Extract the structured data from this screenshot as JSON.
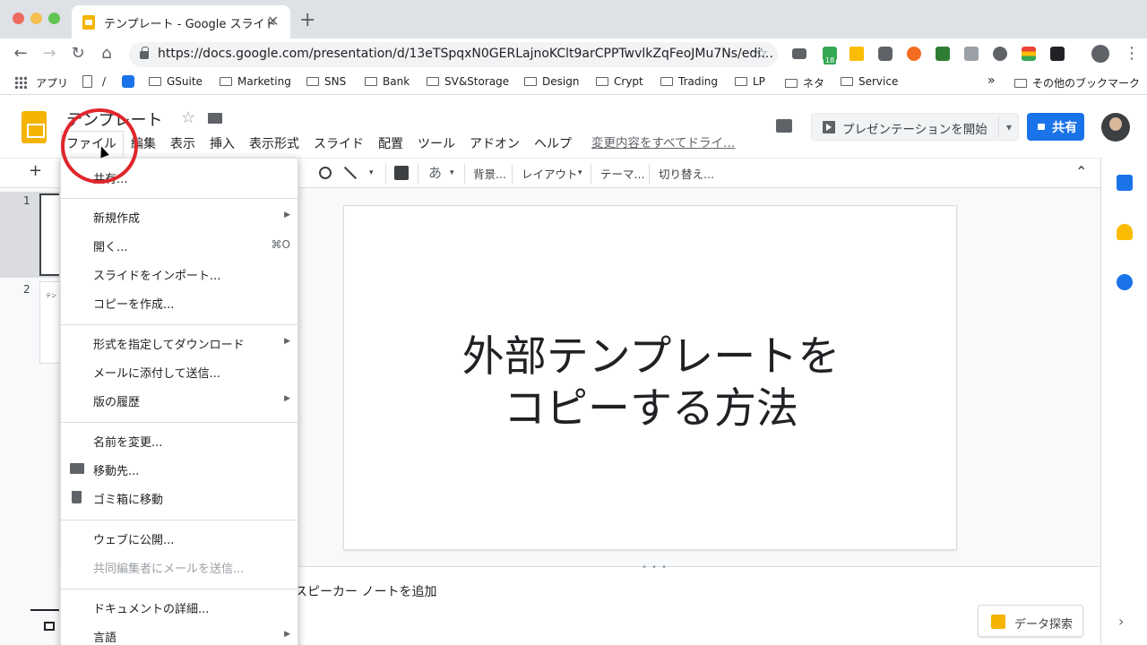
{
  "browser": {
    "tab_title": "テンプレート - Google スライド",
    "tab_close": "✕",
    "new_tab": "+",
    "url": "https://docs.google.com/presentation/d/13eTSpqxN0GERLajnoKClt9arCPPTwvlkZqFeoJMu7Ns/edi…",
    "ext_badge": "18"
  },
  "bookmarks": {
    "apps": "アプリ",
    "slash": "/",
    "items": [
      "GSuite",
      "Marketing",
      "SNS",
      "Bank",
      "SV&Storage",
      "Design",
      "Crypt",
      "Trading",
      "LP",
      "ネタ",
      "Service"
    ],
    "more": "»",
    "other": "その他のブックマーク"
  },
  "doc": {
    "title": "テンプレート",
    "last_edit": "変更内容をすべてドライ…",
    "menus": [
      "ファイル",
      "編集",
      "表示",
      "挿入",
      "表示形式",
      "スライド",
      "配置",
      "ツール",
      "アドオン",
      "ヘルプ"
    ],
    "present_label": "プレゼンテーションを開始",
    "share_label": "共有"
  },
  "toolbar": {
    "add": "+",
    "text_style": "あ",
    "background": "背景...",
    "layout": "レイアウト",
    "theme": "テーマ...",
    "transition": "切り替え...",
    "collapse": "⌃"
  },
  "filmstrip": {
    "slides": [
      "1",
      "2"
    ],
    "thumb2_text": "テン"
  },
  "slide": {
    "title_line1": "外部テンプレートを",
    "title_line2": "コピーする方法"
  },
  "notes": {
    "placeholder": "スピーカー ノートを追加"
  },
  "explore": {
    "label": "データ探索"
  },
  "file_menu": {
    "share": "共有...",
    "new": "新規作成",
    "open": "開く...",
    "open_shortcut": "⌘O",
    "import": "スライドをインポート...",
    "copy": "コピーを作成...",
    "download": "形式を指定してダウンロード",
    "email": "メールに添付して送信...",
    "history": "版の履歴",
    "rename": "名前を変更...",
    "move": "移動先...",
    "trash": "ゴミ箱に移動",
    "publish": "ウェブに公開...",
    "email_collab": "共同編集者にメールを送信...",
    "details": "ドキュメントの詳細...",
    "language": "言語"
  },
  "colors": {
    "accent": "#1a73e8",
    "slides_yellow": "#f4b400",
    "annotation_red": "#e0262c"
  }
}
